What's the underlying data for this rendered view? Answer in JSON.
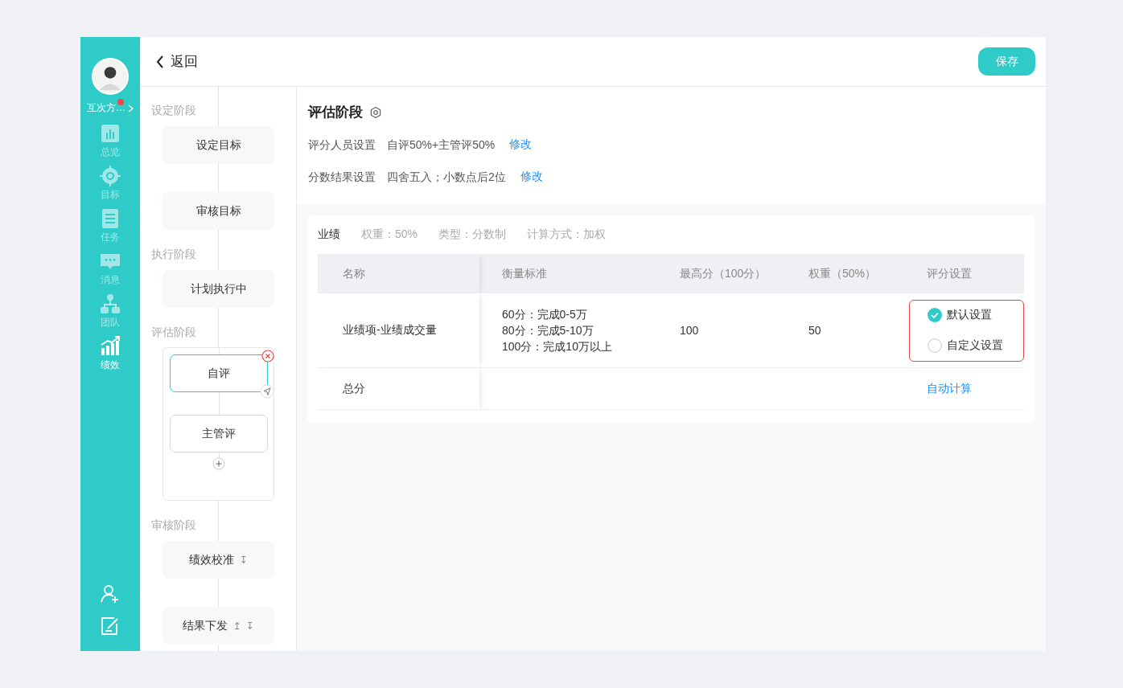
{
  "sidebar": {
    "user": {
      "name": "互次方…",
      "notification": true
    },
    "items": [
      {
        "label": "总览",
        "selected": false
      },
      {
        "label": "目标",
        "selected": false
      },
      {
        "label": "任务",
        "selected": false
      },
      {
        "label": "消息",
        "selected": false
      },
      {
        "label": "团队",
        "selected": false
      },
      {
        "label": "绩效",
        "selected": true
      }
    ]
  },
  "header": {
    "back": "返回",
    "save": "保存"
  },
  "flow": [
    {
      "stage": "设定阶段",
      "kind": "list",
      "nodes": [
        {
          "label": "设定目标"
        },
        {
          "label": "审核目标"
        }
      ]
    },
    {
      "stage": "执行阶段",
      "kind": "list",
      "nodes": [
        {
          "label": "计划执行中"
        }
      ]
    },
    {
      "stage": "评估阶段",
      "kind": "group",
      "nodes": [
        {
          "label": "自评",
          "selected": true
        },
        {
          "label": "主管评",
          "selected": false
        }
      ]
    },
    {
      "stage": "审核阶段",
      "kind": "list",
      "nodes": [
        {
          "label": "绩效校准",
          "marks": [
            "↧"
          ]
        },
        {
          "label": "结果下发",
          "marks": [
            "↥",
            "↧"
          ]
        }
      ]
    }
  ],
  "stage": {
    "title": "评估阶段",
    "settings": [
      {
        "label": "评分人员设置",
        "value": "自评50%+主管评50%",
        "action": "修改"
      },
      {
        "label": "分数结果设置",
        "value": "四舍五入；小数点后2位",
        "action": "修改"
      }
    ]
  },
  "section": {
    "title": "业绩",
    "meta": [
      "权重：50%",
      "类型：分数制",
      "计算方式：加权"
    ]
  },
  "table": {
    "columns": [
      "名称",
      "衡量标准",
      "最高分（100分）",
      "权重（50%）",
      "评分设置"
    ],
    "rows": [
      {
        "name": "业绩项-业绩成交量",
        "criteria": [
          "60分：完成0-5万",
          "80分：完成5-10万",
          "100分：完成10万以上"
        ],
        "max": "100",
        "weight": "50",
        "highlighted": true,
        "options": [
          {
            "label": "默认设置",
            "selected": true
          },
          {
            "label": "自定义设置",
            "selected": false
          }
        ]
      }
    ],
    "total": {
      "label": "总分",
      "action": "自动计算"
    }
  }
}
